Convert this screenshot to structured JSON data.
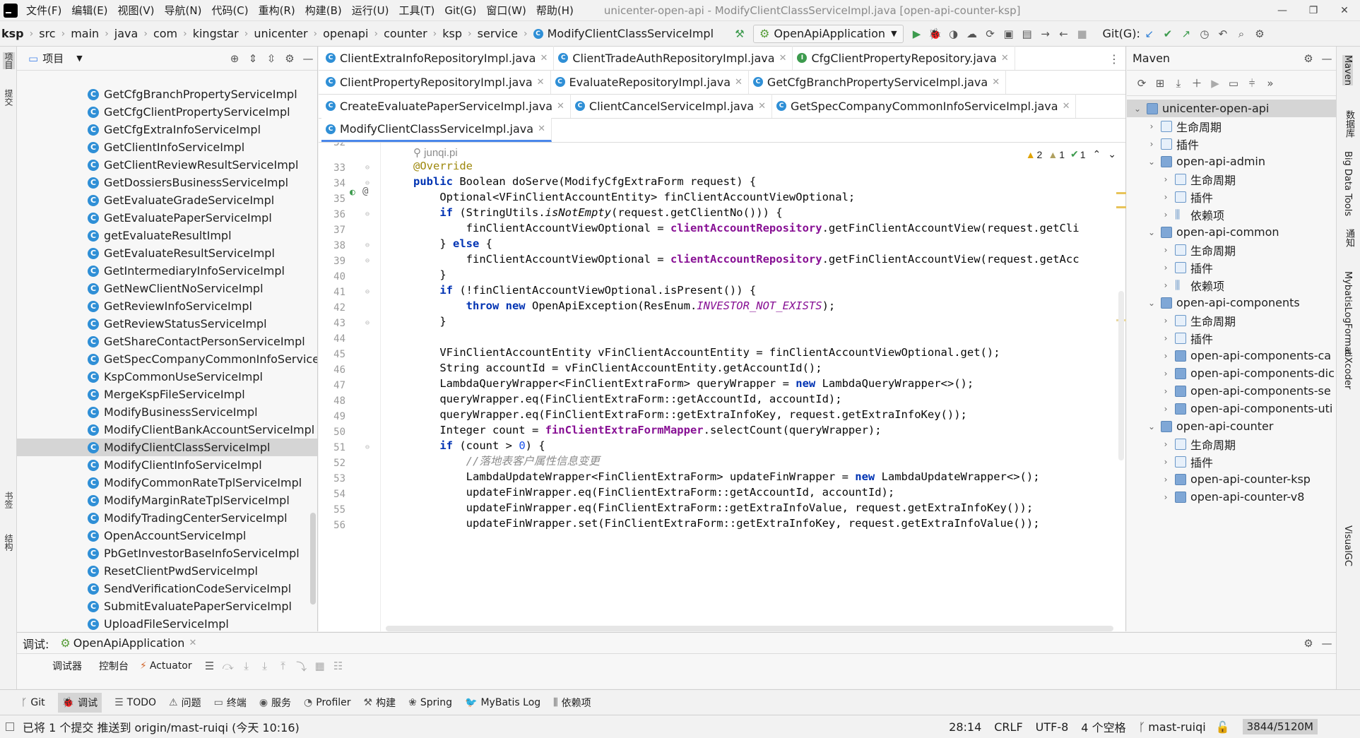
{
  "menubar": {
    "items": [
      "文件(F)",
      "编辑(E)",
      "视图(V)",
      "导航(N)",
      "代码(C)",
      "重构(R)",
      "构建(B)",
      "运行(U)",
      "工具(T)",
      "Git(G)",
      "窗口(W)",
      "帮助(H)"
    ],
    "window_title": "unicenter-open-api - ModifyClientClassServiceImpl.java [open-api-counter-ksp]"
  },
  "breadcrumb": [
    "ksp",
    "src",
    "main",
    "java",
    "com",
    "kingstar",
    "unicenter",
    "openapi",
    "counter",
    "ksp",
    "service",
    "ModifyClientClassServiceImpl"
  ],
  "toolbar": {
    "run_config": "OpenApiApplication",
    "git_label": "Git(G):"
  },
  "left_stripe": {
    "project": "项目",
    "commit": "提交",
    "bookmarks": "书签",
    "structure": "结构"
  },
  "project_panel": {
    "title": "项目",
    "items": [
      "GetCfgBranchPropertyServiceImpl",
      "GetCfgClientPropertyServiceImpl",
      "GetCfgExtraInfoServiceImpl",
      "GetClientInfoServiceImpl",
      "GetClientReviewResultServiceImpl",
      "GetDossiersBusinessServiceImpl",
      "GetEvaluateGradeServiceImpl",
      "GetEvaluatePaperServiceImpl",
      "getEvaluateResultImpl",
      "GetEvaluateResultServiceImpl",
      "GetIntermediaryInfoServiceImpl",
      "GetNewClientNoServiceImpl",
      "GetReviewInfoServiceImpl",
      "GetReviewStatusServiceImpl",
      "GetShareContactPersonServiceImpl",
      "GetSpecCompanyCommonInfoServiceImpl",
      "KspCommonUseServiceImpl",
      "MergeKspFileServiceImpl",
      "ModifyBusinessServiceImpl",
      "ModifyClientBankAccountServiceImpl",
      "ModifyClientClassServiceImpl",
      "ModifyClientInfoServiceImpl",
      "ModifyCommonRateTplServiceImpl",
      "ModifyMarginRateTplServiceImpl",
      "ModifyTradingCenterServiceImpl",
      "OpenAccountServiceImpl",
      "PbGetInvestorBaseInfoServiceImpl",
      "ResetClientPwdServiceImpl",
      "SendVerificationCodeServiceImpl",
      "SubmitEvaluatePaperServiceImpl",
      "UploadFileServiceImpl"
    ],
    "selected_index": 20
  },
  "editor_tabs": {
    "row1": [
      "ClientExtraInfoRepositoryImpl.java",
      "ClientTradeAuthRepositoryImpl.java",
      "CfgClientPropertyRepository.java"
    ],
    "row2": [
      "ClientPropertyRepositoryImpl.java",
      "EvaluateRepositoryImpl.java",
      "GetCfgBranchPropertyServiceImpl.java"
    ],
    "row3": [
      "CreateEvaluatePaperServiceImpl.java",
      "ClientCancelServiceImpl.java",
      "GetSpecCompanyCommonInfoServiceImpl.java"
    ],
    "row4": [
      "ModifyClientClassServiceImpl.java"
    ]
  },
  "editor": {
    "author": "junqi.pi",
    "inspections": {
      "warnings": "2",
      "weak_warnings": "1",
      "ok": "1"
    },
    "line_numbers": [
      "33",
      "34",
      "35",
      "36",
      "37",
      "38",
      "39",
      "40",
      "41",
      "42",
      "43",
      "44",
      "45",
      "46",
      "47",
      "48",
      "49",
      "50",
      "51",
      "52",
      "53",
      "54",
      "55",
      "56"
    ]
  },
  "maven": {
    "title": "Maven",
    "tree": [
      {
        "label": "unicenter-open-api",
        "level": 0,
        "type": "module",
        "open": true
      },
      {
        "label": "生命周期",
        "level": 1,
        "type": "lifecycle"
      },
      {
        "label": "插件",
        "level": 1,
        "type": "plugins"
      },
      {
        "label": "open-api-admin",
        "level": 1,
        "type": "module",
        "open": true
      },
      {
        "label": "生命周期",
        "level": 2,
        "type": "lifecycle"
      },
      {
        "label": "插件",
        "level": 2,
        "type": "plugins"
      },
      {
        "label": "依赖项",
        "level": 2,
        "type": "deps"
      },
      {
        "label": "open-api-common",
        "level": 1,
        "type": "module",
        "open": true
      },
      {
        "label": "生命周期",
        "level": 2,
        "type": "lifecycle"
      },
      {
        "label": "插件",
        "level": 2,
        "type": "plugins"
      },
      {
        "label": "依赖项",
        "level": 2,
        "type": "deps"
      },
      {
        "label": "open-api-components",
        "level": 1,
        "type": "module",
        "open": true
      },
      {
        "label": "生命周期",
        "level": 2,
        "type": "lifecycle"
      },
      {
        "label": "插件",
        "level": 2,
        "type": "plugins"
      },
      {
        "label": "open-api-components-ca",
        "level": 2,
        "type": "module"
      },
      {
        "label": "open-api-components-dic",
        "level": 2,
        "type": "module"
      },
      {
        "label": "open-api-components-se",
        "level": 2,
        "type": "module"
      },
      {
        "label": "open-api-components-uti",
        "level": 2,
        "type": "module"
      },
      {
        "label": "open-api-counter",
        "level": 1,
        "type": "module",
        "open": true
      },
      {
        "label": "生命周期",
        "level": 2,
        "type": "lifecycle"
      },
      {
        "label": "插件",
        "level": 2,
        "type": "plugins"
      },
      {
        "label": "open-api-counter-ksp",
        "level": 2,
        "type": "module"
      },
      {
        "label": "open-api-counter-v8",
        "level": 2,
        "type": "module"
      }
    ]
  },
  "right_stripe": [
    "Maven",
    "数据库",
    "Big Data Tools",
    "通知",
    "MybatisLogFormat",
    "aiXcoder",
    "VisualGC"
  ],
  "debug_panel": {
    "label": "调试:",
    "session": "OpenApiApplication",
    "tabs": [
      "调试器",
      "控制台",
      "Actuator"
    ]
  },
  "bottom_tools": [
    "Git",
    "调试",
    "TODO",
    "问题",
    "终端",
    "服务",
    "Profiler",
    "构建",
    "Spring",
    "MyBatis Log",
    "依赖项"
  ],
  "status": {
    "message": "已将 1 个提交 推送到 origin/mast-ruiqi (今天 10:16)",
    "position": "28:14",
    "line_sep": "CRLF",
    "encoding": "UTF-8",
    "indent": "4 个空格",
    "branch": "mast-ruiqi",
    "memory": "3844/5120M"
  }
}
